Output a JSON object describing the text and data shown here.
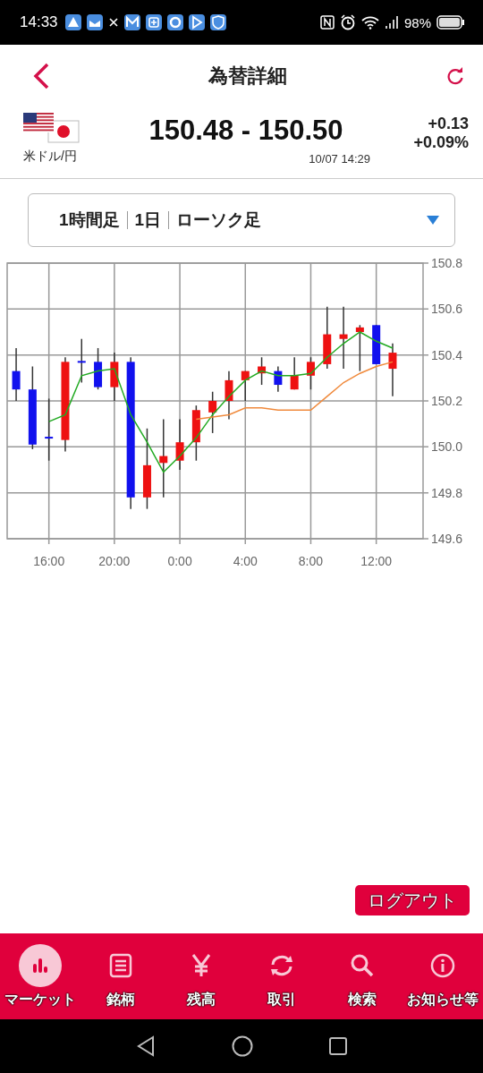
{
  "status_bar": {
    "time": "14:33",
    "battery": "98%"
  },
  "header": {
    "title": "為替詳細"
  },
  "quote": {
    "pair": "米ドル/円",
    "price": "150.48 - 150.50",
    "change": "+0.13",
    "change_pct": "+0.09%",
    "timestamp": "10/07 14:29"
  },
  "chart_selector": {
    "options": [
      "1時間足",
      "1日",
      "ローソク足"
    ]
  },
  "chart": {
    "chart_data": {
      "type": "candlestick",
      "categories": [
        null,
        null,
        "16:00",
        null,
        null,
        null,
        "20:00",
        null,
        null,
        null,
        "0:00",
        null,
        null,
        null,
        "4:00",
        null,
        null,
        null,
        "8:00",
        null,
        null,
        null,
        "12:00",
        null
      ],
      "ylim": [
        149.6,
        150.8
      ],
      "grid": true,
      "yticks": [
        {
          "value": 150.8,
          "label": "150.8"
        },
        {
          "value": 150.6,
          "label": "150.6"
        },
        {
          "value": 150.4,
          "label": "150.4"
        },
        {
          "value": 150.2,
          "label": "150.2"
        },
        {
          "value": 150.0,
          "label": "150.0"
        },
        {
          "value": 149.8,
          "label": "149.8"
        },
        {
          "value": 149.6,
          "label": "149.6"
        }
      ],
      "ohlc": [
        [
          150.33,
          150.43,
          150.2,
          150.25
        ],
        [
          150.25,
          150.35,
          149.99,
          150.01
        ],
        [
          150.04,
          150.21,
          149.94,
          150.04
        ],
        [
          150.03,
          150.39,
          149.98,
          150.37
        ],
        [
          150.37,
          150.47,
          150.28,
          150.37
        ],
        [
          150.37,
          150.43,
          150.25,
          150.26
        ],
        [
          150.26,
          150.41,
          150.2,
          150.37
        ],
        [
          150.37,
          150.39,
          149.73,
          149.78
        ],
        [
          149.78,
          150.08,
          149.73,
          149.92
        ],
        [
          149.93,
          150.12,
          149.78,
          149.96
        ],
        [
          149.94,
          150.12,
          149.9,
          150.02
        ],
        [
          150.02,
          150.18,
          149.94,
          150.16
        ],
        [
          150.15,
          150.24,
          150.06,
          150.2
        ],
        [
          150.2,
          150.33,
          150.12,
          150.29
        ],
        [
          150.29,
          150.33,
          150.2,
          150.33
        ],
        [
          150.32,
          150.39,
          150.27,
          150.35
        ],
        [
          150.33,
          150.35,
          150.24,
          150.27
        ],
        [
          150.25,
          150.39,
          150.25,
          150.31
        ],
        [
          150.31,
          150.39,
          150.25,
          150.37
        ],
        [
          150.36,
          150.61,
          150.34,
          150.49
        ],
        [
          150.47,
          150.61,
          150.34,
          150.49
        ],
        [
          150.5,
          150.53,
          150.33,
          150.52
        ],
        [
          150.53,
          150.53,
          150.36,
          150.36
        ],
        [
          150.34,
          150.45,
          150.22,
          150.41
        ]
      ],
      "series": [
        {
          "type": "line",
          "color": "#22aa22",
          "values": [
            null,
            null,
            150.11,
            150.14,
            150.31,
            150.33,
            150.34,
            150.14,
            150.02,
            149.89,
            149.96,
            150.04,
            150.14,
            150.22,
            150.29,
            150.33,
            150.31,
            150.31,
            150.32,
            150.39,
            150.45,
            150.5,
            150.46,
            150.43
          ]
        },
        {
          "type": "line",
          "color": "#f08a3c",
          "values": [
            null,
            null,
            null,
            null,
            null,
            null,
            null,
            null,
            null,
            null,
            null,
            150.12,
            150.13,
            150.14,
            150.17,
            150.17,
            150.16,
            150.16,
            150.16,
            150.22,
            150.28,
            150.32,
            150.35,
            150.37
          ]
        }
      ]
    }
  },
  "logout_button": {
    "label": "ログアウト"
  },
  "bottom_nav": [
    {
      "label": "マーケット",
      "selected": true
    },
    {
      "label": "銘柄",
      "selected": false
    },
    {
      "label": "残高",
      "selected": false
    },
    {
      "label": "取引",
      "selected": false
    },
    {
      "label": "検索",
      "selected": false
    },
    {
      "label": "お知らせ等",
      "selected": false
    }
  ]
}
